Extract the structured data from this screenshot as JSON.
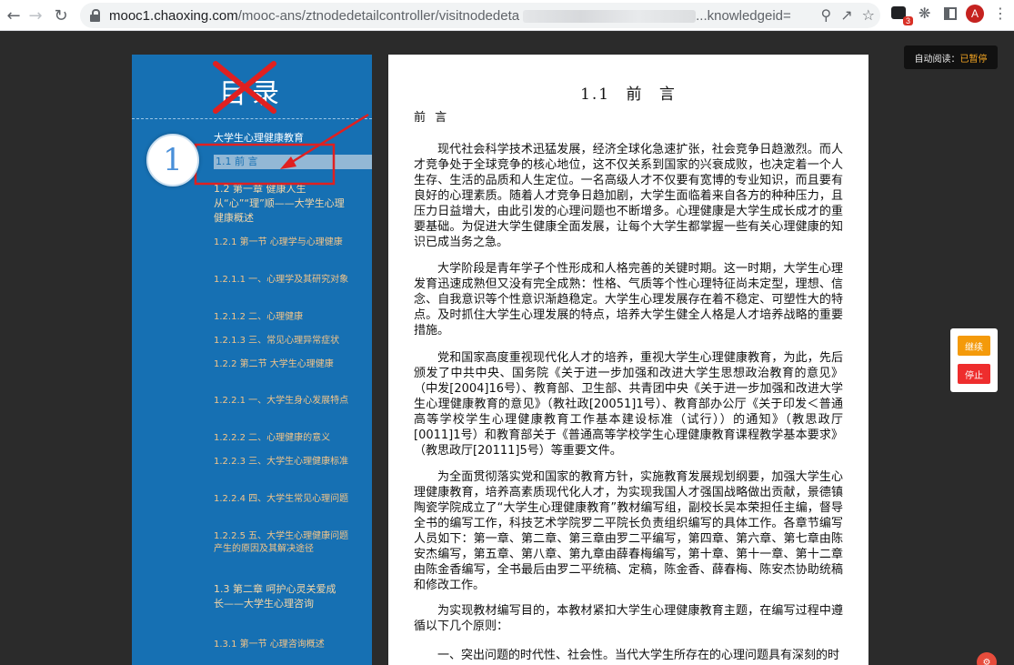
{
  "browser": {
    "url_host": "mooc1.chaoxing.com",
    "url_path": "/mooc-ans/ztnodedetailcontroller/visitnodedeta",
    "url_tail": "...knowledgeid=",
    "extension_badge": "3",
    "profile_initial": "A"
  },
  "sidebar": {
    "title": "目录",
    "items": [
      {
        "label": "大学生心理健康教育"
      },
      {
        "label": "1.1 前 言"
      },
      {
        "label": "1.2 第一章 健康人生从“心”“理”顺——大学生心理健康概述"
      },
      {
        "label": "1.2.1 第一节 心理学与心理健康"
      },
      {
        "label": "1.2.1.1 一、心理学及其研究对象"
      },
      {
        "label": "1.2.1.2 二、心理健康"
      },
      {
        "label": "1.2.1.3 三、常见心理异常症状"
      },
      {
        "label": "1.2.2 第二节 大学生心理健康"
      },
      {
        "label": "1.2.2.1 一、大学生身心发展特点"
      },
      {
        "label": "1.2.2.2 二、心理健康的意义"
      },
      {
        "label": "1.2.2.3 三、大学生心理健康标准"
      },
      {
        "label": "1.2.2.4 四、大学生常见心理问题"
      },
      {
        "label": "1.2.2.5 五、大学生心理健康问题产生的原因及其解决途径"
      },
      {
        "label": "1.3 第二章 呵护心灵关爱成长——大学生心理咨询"
      },
      {
        "label": "1.3.1 第一节 心理咨询概述"
      }
    ],
    "annotation_number": "1"
  },
  "content": {
    "title": "1.1  前  言",
    "subtitle": "前 言",
    "paragraphs": [
      "现代社会科学技术迅猛发展，经济全球化急速扩张，社会竞争日趋激烈。而人才竞争处于全球竞争的核心地位，这不仅关系到国家的兴衰成败，也决定着一个人生存、生活的品质和人生定位。一名高级人才不仅要有宽博的专业知识，而且要有良好的心理素质。随着人才竞争日趋加剧，大学生面临着来自各方的种种压力，且压力日益增大，由此引发的心理问题也不断增多。心理健康是大学生成长成才的重要基础。为促进大学生健康全面发展，让每个大学生都掌握一些有关心理健康的知识已成当务之急。",
      "大学阶段是青年学子个性形成和人格完善的关键时期。这一时期，大学生心理发育迅速成熟但又没有完全成熟：性格、气质等个性心理特征尚未定型，理想、信念、自我意识等个性意识渐趋稳定。大学生心理发展存在着不稳定、可塑性大的特点。及时抓住大学生心理发展的特点，培养大学生健全人格是人才培养战略的重要措施。",
      "党和国家高度重视现代化人才的培养，重视大学生心理健康教育，为此，先后颁发了中共中央、国务院《关于进一步加强和改进大学生思想政治教育的意见》（中发[2004]16号）、教育部、卫生部、共青团中央《关于进一步加强和改进大学生心理健康教育的意见》（教社政[20051]1号）、教育部办公厅《关于印发＜普通高等学校学生心理健康教育工作基本建设标准（试行））的通知》（教思政厅[0011]1号）和教育部关于《普通高等学校学生心理健康教育课程教学基本要求》（教思政厅[20111]5号）等重要文件。",
      "为全面贯彻落实党和国家的教育方针，实施教育发展规划纲要，加强大学生心理健康教育，培养高素质现代化人才，为实现我国人才强国战略做出贡献，景德镇陶瓷学院成立了“大学生心理健康教育”教材编写组，副校长吴本荣担任主编，督导全书的编写工作，科技艺术学院罗二平院长负责组织编写的具体工作。各章节编写人员如下：第一章、第二章、第三章由罗二平编写，第四章、第六章、第七章由陈安杰编写，第五章、第八章、第九章由薛春梅编写，第十章、第十一章、第十二章由陈金香编写，全书最后由罗二平统稿、定稿，陈金香、薛春梅、陈安杰协助统稿和修改工作。",
      "为实现教材编写目的，本教材紧扣大学生心理健康教育主题，在编写过程中遵循以下几个原则：",
      "一、突出问题的时代性、社会性。当代大学生所存在的心理问题具有深刻的时"
    ]
  },
  "auto_read": {
    "label": "自动阅读：",
    "state": "已暂停"
  },
  "float_buttons": {
    "continue": "继续",
    "stop": "停止"
  },
  "corner_icon": "⚙",
  "colors": {
    "sidebar_bg": "#1670b3",
    "toc_text": "#f3c58a",
    "annotation_red": "#e02020"
  }
}
